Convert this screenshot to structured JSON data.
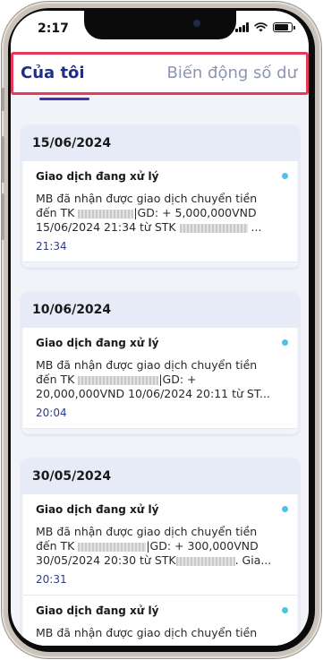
{
  "status_bar": {
    "time": "2:17",
    "battery_level": 0.85
  },
  "tabs": {
    "active_label": "Của tôi",
    "inactive_label": "Biến động số dư"
  },
  "groups": [
    {
      "date": "15/06/2024",
      "items": [
        {
          "title": "Giao dịch đang xử lý",
          "line1": "MB đã nhận được giao dịch chuyển tiền",
          "line2_a": "đến TK",
          "line2_b": "|GD: + 5,000,000VND",
          "line3_a": "15/06/2024 21:34 từ STK",
          "line3_b": " ...",
          "time": "21:34"
        }
      ]
    },
    {
      "date": "10/06/2024",
      "items": [
        {
          "title": "Giao dịch đang xử lý",
          "line1": "MB đã nhận được giao dịch chuyển tiền",
          "line2_a": "đến TK",
          "line2_b": "|GD: +",
          "line3_a": "20,000,000VND 10/06/2024 20:11 từ ST...",
          "line3_b": "",
          "time": "20:04"
        }
      ]
    },
    {
      "date": "30/05/2024",
      "items": [
        {
          "title": "Giao dịch đang xử lý",
          "line1": "MB đã nhận được giao dịch chuyển tiền",
          "line2_a": "đến TK",
          "line2_b": "|GD: + 300,000VND",
          "line3_a": "30/05/2024 20:30 từ STK",
          "line3_b": ". Gia...",
          "time": "20:31"
        },
        {
          "title": "Giao dịch đang xử lý",
          "line1": "MB đã nhận được giao dịch chuyển tiền",
          "line2_a": "",
          "line2_b": "",
          "line3_a": "",
          "line3_b": "",
          "time": ""
        }
      ]
    }
  ]
}
